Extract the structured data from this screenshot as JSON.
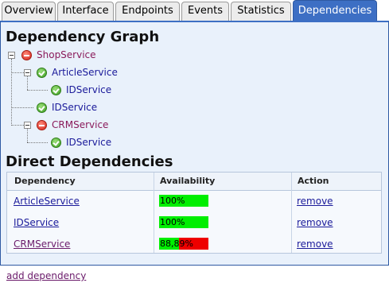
{
  "tabs": [
    {
      "label": "Overview",
      "active": false
    },
    {
      "label": "Interface",
      "active": false
    },
    {
      "label": "Endpoints",
      "active": false
    },
    {
      "label": "Events",
      "active": false
    },
    {
      "label": "Statistics",
      "active": false
    },
    {
      "label": "Dependencies",
      "active": true
    }
  ],
  "graph": {
    "title": "Dependency Graph",
    "nodes": [
      {
        "label": "ShopService",
        "status": "error",
        "status_icon": "minus-circle-icon",
        "expanded": true
      },
      {
        "label": "ArticleService",
        "status": "ok",
        "status_icon": "check-circle-icon",
        "expanded": true
      },
      {
        "label": "IDService",
        "status": "ok",
        "status_icon": "check-circle-icon"
      },
      {
        "label": "IDService",
        "status": "ok",
        "status_icon": "check-circle-icon"
      },
      {
        "label": "CRMService",
        "status": "error",
        "status_icon": "minus-circle-icon",
        "expanded": true
      },
      {
        "label": "IDService",
        "status": "ok",
        "status_icon": "check-circle-icon"
      }
    ]
  },
  "direct": {
    "title": "Direct Dependencies",
    "columns": [
      "Dependency",
      "Availability",
      "Action"
    ],
    "rows": [
      {
        "name": "ArticleService",
        "availability_text": "100%",
        "availability": 1.0,
        "action": "remove"
      },
      {
        "name": "IDService",
        "availability_text": "100%",
        "availability": 1.0,
        "action": "remove"
      },
      {
        "name": "CRMService",
        "availability_text": "88,89%",
        "availability": 0.4,
        "action": "remove"
      }
    ]
  },
  "add_link": "add dependency",
  "colors": {
    "tab_active": "#3d6fc4",
    "panel": "#e9f1fb",
    "ok": "#00ee00",
    "fail": "#ee0000"
  }
}
